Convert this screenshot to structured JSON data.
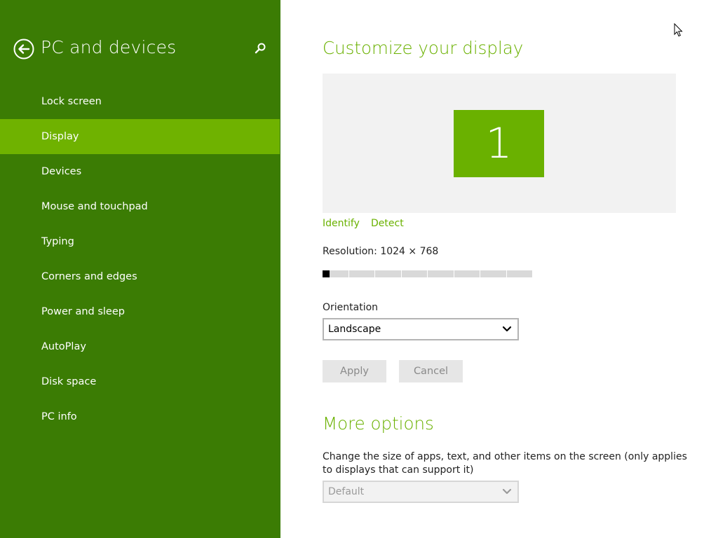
{
  "nav": {
    "title": "PC and devices",
    "back_icon": "back-arrow-circle-icon",
    "search_icon": "search-icon",
    "items": [
      {
        "label": "Lock screen",
        "selected": false
      },
      {
        "label": "Display",
        "selected": true
      },
      {
        "label": "Devices",
        "selected": false
      },
      {
        "label": "Mouse and touchpad",
        "selected": false
      },
      {
        "label": "Typing",
        "selected": false
      },
      {
        "label": "Corners and edges",
        "selected": false
      },
      {
        "label": "Power and sleep",
        "selected": false
      },
      {
        "label": "AutoPlay",
        "selected": false
      },
      {
        "label": "Disk space",
        "selected": false
      },
      {
        "label": "PC info",
        "selected": false
      }
    ]
  },
  "main": {
    "heading": "Customize your display",
    "monitor_number": "1",
    "identify_link": "Identify",
    "detect_link": "Detect",
    "resolution_label": "Resolution: 1024 × 768",
    "resolution_slider": {
      "segments": 8,
      "position": 0
    },
    "orientation_label": "Orientation",
    "orientation_value": "Landscape",
    "apply_button": "Apply",
    "cancel_button": "Cancel",
    "more_options_heading": "More options",
    "scaling_description": "Change the size of apps, text, and other items on the screen (only applies to displays that can support it)",
    "scaling_value": "Default"
  },
  "colors": {
    "nav_background": "#3b7c04",
    "nav_selected": "#6fb200",
    "accent": "#6ab100",
    "preview_background": "#f2f2f2",
    "button_background": "#e6e6e6"
  }
}
